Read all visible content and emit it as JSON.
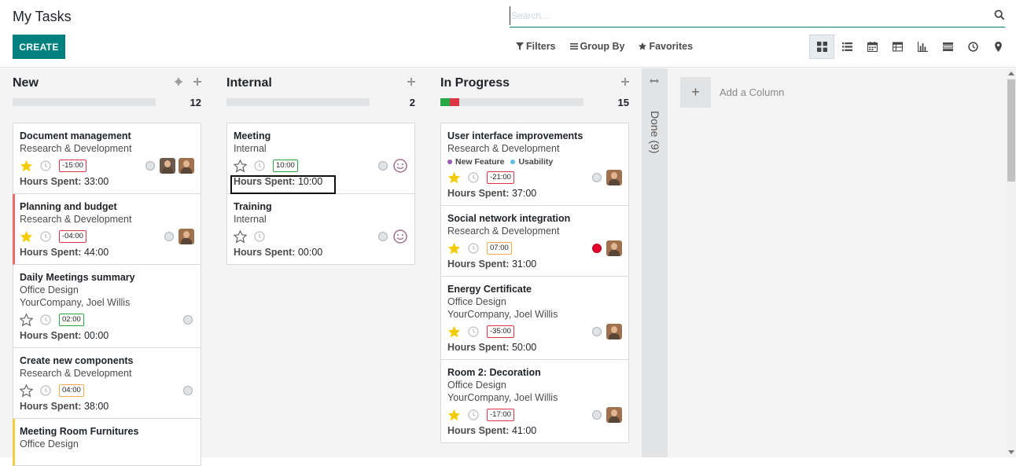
{
  "header": {
    "title": "My Tasks",
    "create_label": "CREATE",
    "search_placeholder": "Search...",
    "filters_label": "Filters",
    "groupby_label": "Group By",
    "favorites_label": "Favorites"
  },
  "columns": [
    {
      "title": "New",
      "count": "12",
      "cards": [
        {
          "title": "Document management",
          "project": "Research & Development",
          "deadline": "-15:00",
          "hours_label": "Hours Spent:",
          "hours": "33:00"
        },
        {
          "title": "Planning and budget",
          "project": "Research & Development",
          "deadline": "-04:00",
          "hours_label": "Hours Spent:",
          "hours": "44:00"
        },
        {
          "title": "Daily Meetings summary",
          "project": "Office Design",
          "customer": "YourCompany, Joel Willis",
          "deadline": "02:00",
          "hours_label": "Hours Spent:",
          "hours": "00:00"
        },
        {
          "title": "Create new components",
          "project": "Research & Development",
          "deadline": "04:00",
          "hours_label": "Hours Spent:",
          "hours": "38:00"
        },
        {
          "title": "Meeting Room Furnitures",
          "project": "Office Design"
        }
      ]
    },
    {
      "title": "Internal",
      "count": "2",
      "cards": [
        {
          "title": "Meeting",
          "project": "Internal",
          "deadline": "10:00",
          "hours_label": "Hours Spent:",
          "hours": "10:00"
        },
        {
          "title": "Training",
          "project": "Internal",
          "hours_label": "Hours Spent:",
          "hours": "00:00"
        }
      ]
    },
    {
      "title": "In Progress",
      "count": "15",
      "cards": [
        {
          "title": "User interface improvements",
          "project": "Research & Development",
          "tags": [
            "New Feature",
            "Usability"
          ],
          "deadline": "-21:00",
          "hours_label": "Hours Spent:",
          "hours": "37:00"
        },
        {
          "title": "Social network integration",
          "project": "Research & Development",
          "deadline": "07:00",
          "hours_label": "Hours Spent:",
          "hours": "31:00"
        },
        {
          "title": "Energy Certificate",
          "project": "Office Design",
          "customer": "YourCompany, Joel Willis",
          "deadline": "-35:00",
          "hours_label": "Hours Spent:",
          "hours": "50:00"
        },
        {
          "title": "Room 2: Decoration",
          "project": "Office Design",
          "customer": "YourCompany, Joel Willis",
          "deadline": "-17:00",
          "hours_label": "Hours Spent:",
          "hours": "41:00"
        }
      ]
    }
  ],
  "folded_column": {
    "label": "Done (9)"
  },
  "add_column_label": "Add a Column",
  "colors": {
    "primary": "#00817f",
    "tag_new_feature": "#9b59b6",
    "tag_usability": "#5bc0de",
    "blocked": "#e4002b",
    "star": "#f3cc00"
  }
}
